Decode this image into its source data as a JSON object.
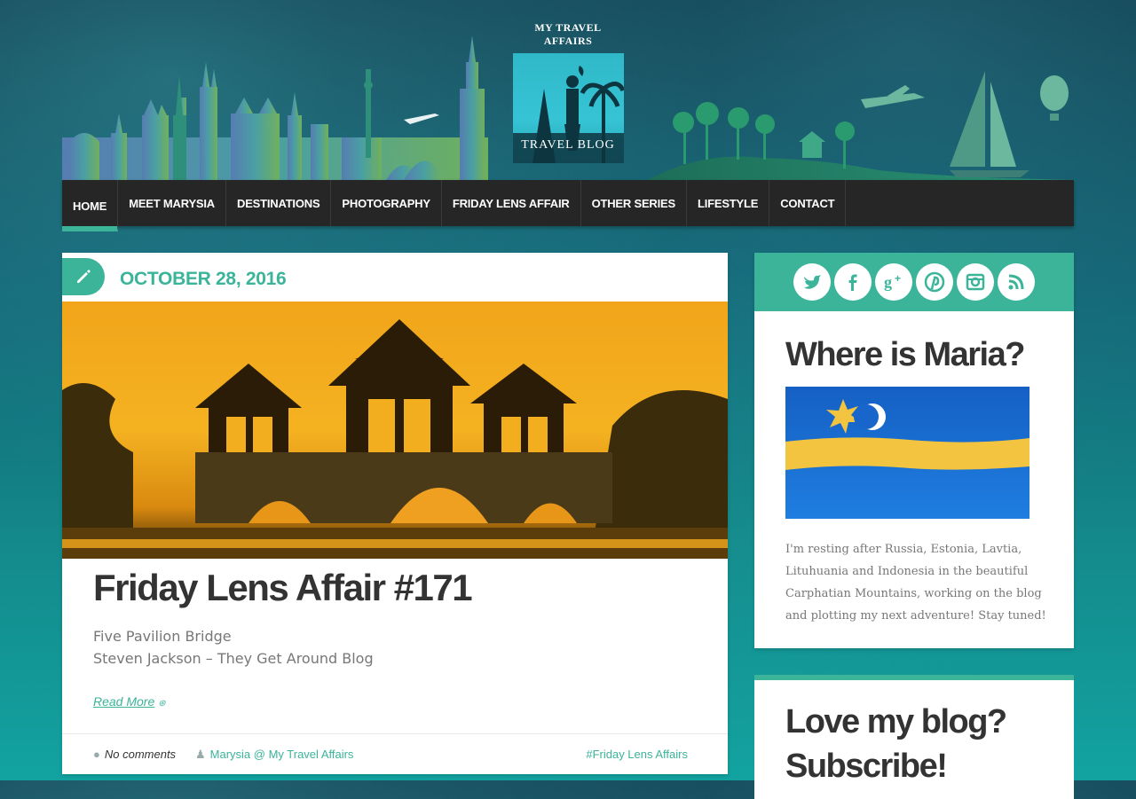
{
  "site": {
    "logo_title": "My Travel Affairs",
    "logo_subtitle": "Travel Blog"
  },
  "nav": {
    "items": [
      {
        "label": "HOME",
        "active": true
      },
      {
        "label": "MEET MARYSIA"
      },
      {
        "label": "DESTINATIONS"
      },
      {
        "label": "PHOTOGRAPHY"
      },
      {
        "label": "FRIDAY LENS AFFAIR"
      },
      {
        "label": "OTHER SERIES"
      },
      {
        "label": "LIFESTYLE"
      },
      {
        "label": "CONTACT"
      }
    ]
  },
  "post": {
    "date": "OCTOBER 28, 2016",
    "title": "Friday Lens Affair #171",
    "excerpt": [
      "Five Pavilion Bridge",
      "Steven Jackson – They Get Around Blog"
    ],
    "read_more": "Read More",
    "comments": "No comments",
    "author": "Marysia @ My Travel Affairs",
    "tag": "#Friday Lens Affairs",
    "icons": {
      "edit": "pencil-icon",
      "comments": "comments-icon",
      "author": "user-icon"
    }
  },
  "sidebar": {
    "social": [
      {
        "name": "twitter-icon"
      },
      {
        "name": "facebook-icon"
      },
      {
        "name": "google-plus-icon"
      },
      {
        "name": "pinterest-icon"
      },
      {
        "name": "instagram-icon"
      },
      {
        "name": "rss-icon"
      }
    ],
    "where_title": "Where is Maria?",
    "where_text": "I'm resting after Russia, Estonia, Lavtia, Lituhuania and Indonesia in the beautiful Carphatian Mountains, working on the blog and plotting my next adventure! Stay tuned!",
    "subscribe_title": "Love my blog? Subscribe!"
  },
  "colors": {
    "accent": "#3bb49a",
    "nav_bg": "#262626",
    "text_dark": "#333333",
    "text_muted": "#777777"
  }
}
